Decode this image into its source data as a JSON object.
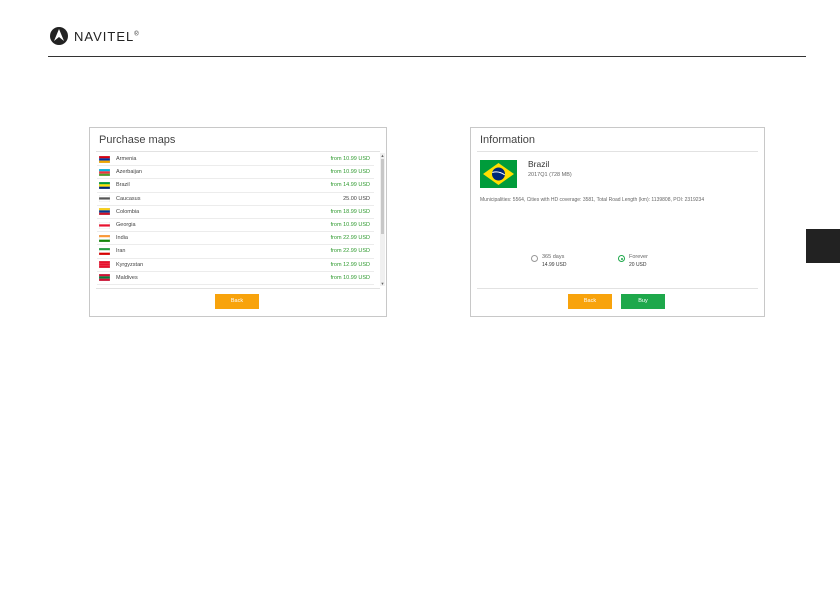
{
  "brand": {
    "name": "NAVITEL",
    "mark": "®"
  },
  "purchase": {
    "title": "Purchase maps",
    "items": [
      {
        "name": "Armenia",
        "price": "from 10.99 USD",
        "flag": [
          "#d90012",
          "#0033a0",
          "#f2a800"
        ]
      },
      {
        "name": "Azerbaijan",
        "price": "from 10.99 USD",
        "flag": [
          "#00b5e2",
          "#ef3340",
          "#509e2f"
        ]
      },
      {
        "name": "Brazil",
        "price": "from 14.99 USD",
        "flag": [
          "#009c3b",
          "#ffdf00",
          "#002776"
        ]
      },
      {
        "name": "Caucasus",
        "price": "25.00 USD",
        "flag": [
          "#ffffff",
          "#555555",
          "#ffffff"
        ]
      },
      {
        "name": "Colombia",
        "price": "from 18.99 USD",
        "flag": [
          "#fcd116",
          "#003893",
          "#ce1126"
        ]
      },
      {
        "name": "Georgia",
        "price": "from 10.99 USD",
        "flag": [
          "#ffffff",
          "#e8112d",
          "#ffffff"
        ]
      },
      {
        "name": "India",
        "price": "from 22.99 USD",
        "flag": [
          "#ff9933",
          "#ffffff",
          "#138808"
        ]
      },
      {
        "name": "Iran",
        "price": "from 22.99 USD",
        "flag": [
          "#239f40",
          "#ffffff",
          "#da0000"
        ]
      },
      {
        "name": "Kyrgyzstan",
        "price": "from 12.99 USD",
        "flag": [
          "#e8112d",
          "#e8112d",
          "#e8112d"
        ]
      },
      {
        "name": "Maldives",
        "price": "from 10.99 USD",
        "flag": [
          "#d21034",
          "#007e3a",
          "#d21034"
        ]
      }
    ],
    "back_label": "Back"
  },
  "info": {
    "title": "Information",
    "country": "Brazil",
    "version": "2017Q1 (728 MB)",
    "stats": "Municipalities: 5564, Cities with HD coverage: 3581, Total Road Length (km): 1139808, POI: 2319234",
    "options": [
      {
        "label": "365 days",
        "price": "14.99 USD",
        "selected": false
      },
      {
        "label": "Forever",
        "price": "20 USD",
        "selected": true
      }
    ],
    "back_label": "Back",
    "buy_label": "Buy"
  },
  "colors": {
    "accent_orange": "#f8a30c",
    "accent_green": "#1ea84b",
    "price_green": "#2e9a2e"
  }
}
